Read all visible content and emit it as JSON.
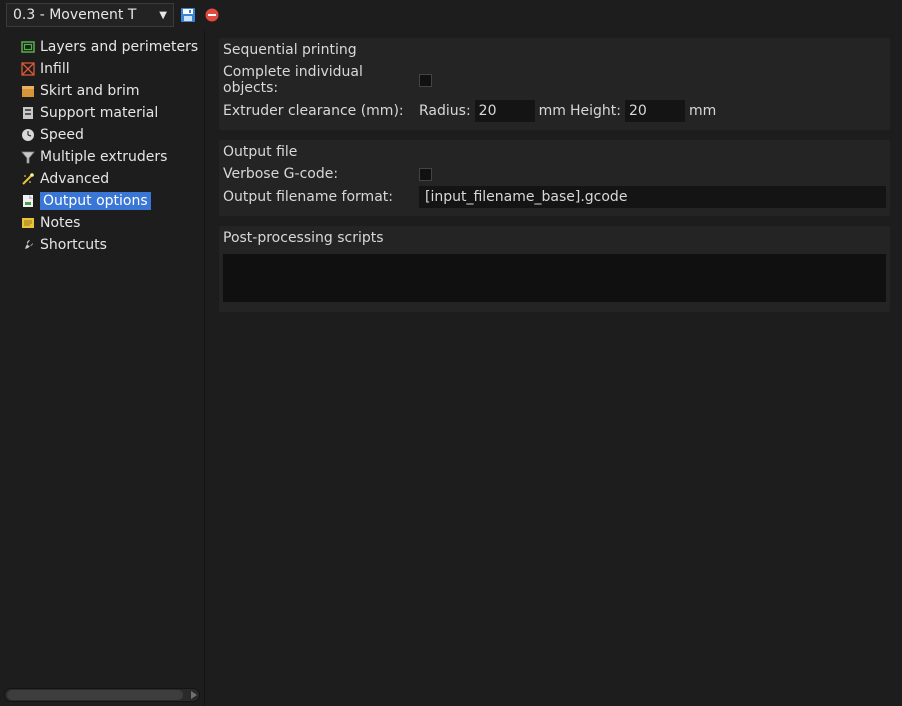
{
  "header": {
    "profile": "0.3 - Movement T"
  },
  "sidebar": {
    "items": [
      {
        "label": "Layers and perimeters"
      },
      {
        "label": "Infill"
      },
      {
        "label": "Skirt and brim"
      },
      {
        "label": "Support material"
      },
      {
        "label": "Speed"
      },
      {
        "label": "Multiple extruders"
      },
      {
        "label": "Advanced"
      },
      {
        "label": "Output options"
      },
      {
        "label": "Notes"
      },
      {
        "label": "Shortcuts"
      }
    ]
  },
  "sections": {
    "sequential": {
      "title": "Sequential printing",
      "complete_label": "Complete individual objects:",
      "clearance_label": "Extruder clearance (mm):",
      "radius_label": "Radius:",
      "radius_value": "20",
      "mm1": "mm",
      "height_label": "Height:",
      "height_value": "20",
      "mm2": "mm"
    },
    "output": {
      "title": "Output file",
      "verbose_label": "Verbose G-code:",
      "filename_label": "Output filename format:",
      "filename_value": "[input_filename_base].gcode"
    },
    "post": {
      "title": "Post-processing scripts",
      "value": ""
    }
  }
}
